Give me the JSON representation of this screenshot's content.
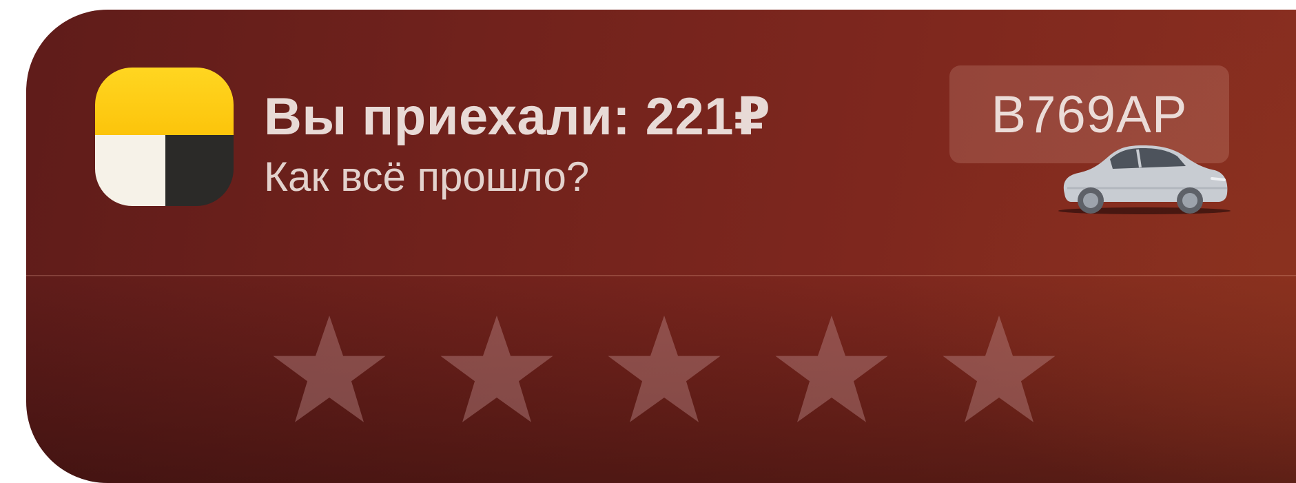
{
  "notification": {
    "app_name": "Yandex Go",
    "title": "Вы приехали: 221₽",
    "subtitle": "Как всё прошло?",
    "license_plate": "В769АР",
    "car_icon": "car-icon"
  },
  "rating": {
    "max": 5,
    "value": 0,
    "star_icon": "star-icon"
  },
  "colors": {
    "background_start": "#5f1c1a",
    "background_end": "#8a2f20",
    "text": "#e8dad6",
    "star": "#7a4a4a",
    "icon_yellow": "#fcc40b",
    "icon_white": "#f6f2e8",
    "icon_black": "#2b2a28"
  }
}
